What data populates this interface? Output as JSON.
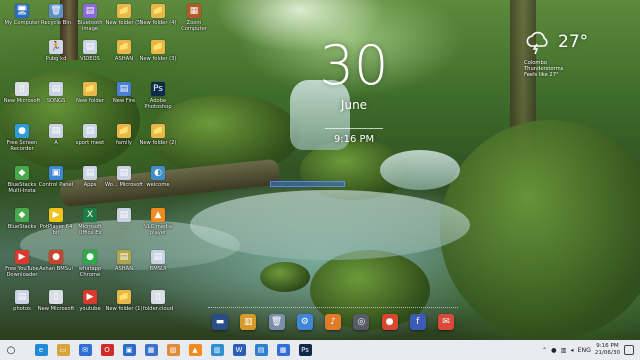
{
  "desktop": {
    "icons": [
      {
        "label": "My Computer",
        "glyph": "🖥",
        "color": "#2b6cc4"
      },
      {
        "label": "Recycle Bin",
        "glyph": "🗑",
        "color": "#5f8fc9"
      },
      {
        "label": "Bluetooth image",
        "glyph": "▤",
        "color": "#8a6ad3"
      },
      {
        "label": "New folder (5)",
        "glyph": "📁",
        "color": "#e8b84a"
      },
      {
        "label": "New folder (4)",
        "glyph": "📁",
        "color": "#e8b84a"
      },
      {
        "label": "Zoom Computer",
        "glyph": "▦",
        "color": "#b45b2a"
      },
      {
        "label": "Pubg kd",
        "glyph": "🏃",
        "color": "#d0d8e8"
      },
      {
        "label": "VIDEOS",
        "glyph": "▤",
        "color": "#c9d3e3"
      },
      {
        "label": "ASHAN",
        "glyph": "📁",
        "color": "#e8b84a"
      },
      {
        "label": "New folder (3)",
        "glyph": "📁",
        "color": "#e8b84a"
      },
      {
        "label": "New Microsoft",
        "glyph": "▯",
        "color": "#d8dde6"
      },
      {
        "label": "SONGS",
        "glyph": "▤",
        "color": "#c9d3e3"
      },
      {
        "label": "New folder",
        "glyph": "📁",
        "color": "#e8b84a"
      },
      {
        "label": "New Fire",
        "glyph": "▤",
        "color": "#4a7fd4"
      },
      {
        "label": "Adobe Photoshop",
        "glyph": "Ps",
        "color": "#0d2a4a"
      },
      {
        "label": "Free Screen Recorder",
        "glyph": "●",
        "color": "#2f9bd8"
      },
      {
        "label": "A",
        "glyph": "▤",
        "color": "#c9d3e3"
      },
      {
        "label": "sport meet",
        "glyph": "▤",
        "color": "#c9d3e3"
      },
      {
        "label": "family",
        "glyph": "📁",
        "color": "#e8b84a"
      },
      {
        "label": "New folder (2)",
        "glyph": "📁",
        "color": "#e8b84a"
      },
      {
        "label": "BlueStacks Multi-Insta",
        "glyph": "◆",
        "color": "#49a84c"
      },
      {
        "label": "Control Panel",
        "glyph": "▣",
        "color": "#3f86d6"
      },
      {
        "label": "Apps",
        "glyph": "▤",
        "color": "#c9d3e3"
      },
      {
        "label": "Wo... Microsoft",
        "glyph": "▤",
        "color": "#c9d3e3"
      },
      {
        "label": "welcome",
        "glyph": "◐",
        "color": "#3f8ec8"
      },
      {
        "label": "BlueStacks",
        "glyph": "◆",
        "color": "#49a84c"
      },
      {
        "label": "PotPlayer 64 bit",
        "glyph": "▶",
        "color": "#f0c21e"
      },
      {
        "label": "Microsoft Office Ex",
        "glyph": "X",
        "color": "#1e7b45"
      },
      {
        "label": "…",
        "glyph": "▤",
        "color": "#c9d3e3"
      },
      {
        "label": "VLC media player",
        "glyph": "▲",
        "color": "#f28a1d"
      },
      {
        "label": "Free YouTube Downloader",
        "glyph": "▶",
        "color": "#d83a2e"
      },
      {
        "label": "Ashan BMSuI",
        "glyph": "●",
        "color": "#c8452d"
      },
      {
        "label": "whatapp Chrome",
        "glyph": "●",
        "color": "#2fa94a"
      },
      {
        "label": "ASHAN",
        "glyph": "▤",
        "color": "#b0a44c"
      },
      {
        "label": "BMSUI",
        "glyph": "▤",
        "color": "#c9d3e3"
      },
      {
        "label": "photos",
        "glyph": "▤",
        "color": "#c9d3e3"
      },
      {
        "label": "New Microsoft",
        "glyph": "▯",
        "color": "#d8dde6"
      },
      {
        "label": "youtube",
        "glyph": "▶",
        "color": "#d83a2e"
      },
      {
        "label": "New folder (1)",
        "glyph": "📁",
        "color": "#e8b84a"
      },
      {
        "label": "folder.cloud",
        "glyph": "▯",
        "color": "#d8dde6"
      }
    ]
  },
  "clock_widget": {
    "day": "30",
    "month": "June",
    "time": "9:16 PM"
  },
  "weather_widget": {
    "temperature": "27°",
    "city": "Colombo",
    "condition": "Thunderstorms",
    "feels_like": "Feels like 27°"
  },
  "dock": {
    "items": [
      {
        "name": "desktop",
        "glyph": "▬",
        "color": "#2b4d8a"
      },
      {
        "name": "folder",
        "glyph": "▥",
        "color": "#d69a2a"
      },
      {
        "name": "recycle-bin",
        "glyph": "🗑",
        "color": "#7c8fa8"
      },
      {
        "name": "settings",
        "glyph": "⚙",
        "color": "#3f86d6"
      },
      {
        "name": "media",
        "glyph": "♪",
        "color": "#e07b2a"
      },
      {
        "name": "camera",
        "glyph": "◎",
        "color": "#555c66"
      },
      {
        "name": "chrome",
        "glyph": "●",
        "color": "#d8472f"
      },
      {
        "name": "facebook",
        "glyph": "f",
        "color": "#3b5bb5"
      },
      {
        "name": "mail",
        "glyph": "✉",
        "color": "#d84a3a"
      }
    ]
  },
  "taskbar": {
    "start_glyph": "○",
    "apps": [
      {
        "name": "edge",
        "glyph": "e",
        "color": "#1f8ad8",
        "active": false
      },
      {
        "name": "file-explorer",
        "glyph": "▭",
        "color": "#d9a53a",
        "active": false
      },
      {
        "name": "mail",
        "glyph": "✉",
        "color": "#2f6fd6",
        "active": false
      },
      {
        "name": "opera",
        "glyph": "O",
        "color": "#d12a2a",
        "active": false
      },
      {
        "name": "store",
        "glyph": "▣",
        "color": "#2b6cc4",
        "active": false
      },
      {
        "name": "photos",
        "glyph": "▦",
        "color": "#3a73c8",
        "active": false
      },
      {
        "name": "paint",
        "glyph": "▨",
        "color": "#e08a3a",
        "active": false
      },
      {
        "name": "vlc",
        "glyph": "▲",
        "color": "#f28a1d",
        "active": false
      },
      {
        "name": "pictures",
        "glyph": "▥",
        "color": "#2f8fd0",
        "active": false
      },
      {
        "name": "word",
        "glyph": "W",
        "color": "#2b5fb5",
        "active": false
      },
      {
        "name": "chat",
        "glyph": "▤",
        "color": "#2f7fd0",
        "active": false
      },
      {
        "name": "calendar",
        "glyph": "▦",
        "color": "#2f6fd6",
        "active": false
      },
      {
        "name": "photoshop",
        "glyph": "Ps",
        "color": "#0d2a4a",
        "active": false
      }
    ],
    "tray": {
      "lang": "ENG",
      "time": "9:16 PM",
      "date": "21/06/30"
    }
  }
}
